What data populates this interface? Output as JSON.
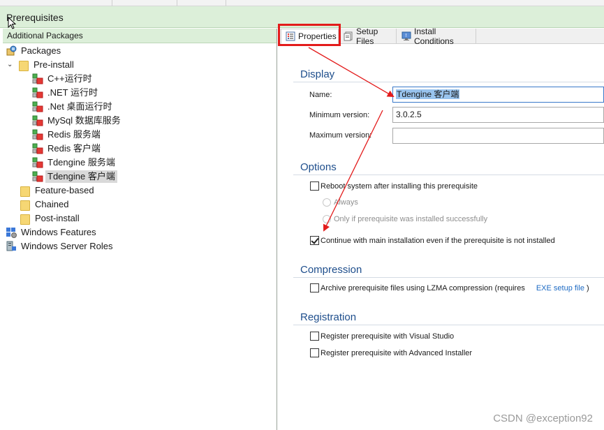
{
  "window": {
    "page_title": "Prerequisites"
  },
  "left_panel": {
    "header": "Additional Packages",
    "tree": [
      {
        "label": "Packages",
        "icon": "packages-icon"
      },
      {
        "label": "Pre-install",
        "icon": "folder-icon",
        "expanded": true
      },
      {
        "label": "C++运行时",
        "icon": "prerequisite-icon"
      },
      {
        "label": ".NET 运行时",
        "icon": "prerequisite-icon"
      },
      {
        "label": ".Net 桌面运行时",
        "icon": "prerequisite-icon"
      },
      {
        "label": "MySql 数据库服务",
        "icon": "prerequisite-icon"
      },
      {
        "label": "Redis 服务端",
        "icon": "prerequisite-icon"
      },
      {
        "label": "Redis 客户端",
        "icon": "prerequisite-icon"
      },
      {
        "label": "Tdengine 服务端",
        "icon": "prerequisite-icon"
      },
      {
        "label": "Tdengine 客户端",
        "icon": "prerequisite-icon",
        "selected": true
      },
      {
        "label": "Feature-based",
        "icon": "folder-icon"
      },
      {
        "label": "Chained",
        "icon": "folder-icon"
      },
      {
        "label": "Post-install",
        "icon": "folder-icon"
      },
      {
        "label": "Windows Features",
        "icon": "windows-features-icon"
      },
      {
        "label": "Windows Server Roles",
        "icon": "server-roles-icon"
      }
    ]
  },
  "tabs": [
    {
      "label": "Properties",
      "icon": "properties-icon",
      "active": true
    },
    {
      "label": "Setup Files",
      "icon": "setup-files-icon"
    },
    {
      "label": "Install Conditions",
      "icon": "install-conditions-icon"
    }
  ],
  "display": {
    "title": "Display",
    "name_label": "Name:",
    "name_value": "Tdengine 客户端",
    "min_version_label": "Minimum version:",
    "min_version_value": "3.0.2.5",
    "max_version_label": "Maximum version:",
    "max_version_value": ""
  },
  "options": {
    "title": "Options",
    "reboot_label": "Reboot system after installing this prerequisite",
    "reboot_checked": false,
    "always_label": "Always",
    "only_if_label": "Only if prerequisite was installed successfully",
    "continue_label": "Continue with main installation even if the prerequisite is not installed",
    "continue_checked": true
  },
  "compression": {
    "title": "Compression",
    "archive_label": "Archive prerequisite files using LZMA compression (requires",
    "archive_link": "EXE setup file",
    "archive_suffix": ")",
    "archive_checked": false
  },
  "registration": {
    "title": "Registration",
    "vs_label": "Register prerequisite with Visual Studio",
    "vs_checked": false,
    "ai_label": "Register prerequisite with Advanced Installer",
    "ai_checked": false
  },
  "watermark": "CSDN @exception92",
  "colors": {
    "accent_green": "#dcefd9",
    "section_blue": "#1e4e8c",
    "annotation_red": "#e31b1b"
  }
}
